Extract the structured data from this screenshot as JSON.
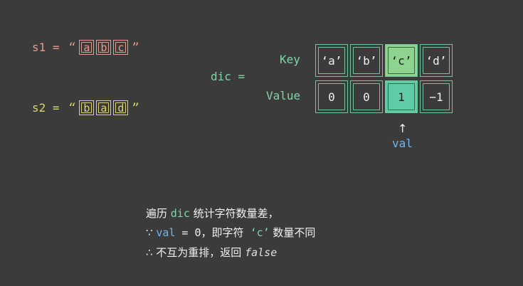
{
  "s1": {
    "label": "s1 = ",
    "open_quote": "“",
    "close_quote": "”",
    "chars": [
      "a",
      "b",
      "c"
    ]
  },
  "s2": {
    "label": "s2 = ",
    "open_quote": "“",
    "close_quote": "”",
    "chars": [
      "b",
      "a",
      "d"
    ]
  },
  "dic": {
    "label": "dic =",
    "key_label": "Key",
    "value_label": "Value",
    "keys": [
      "‘a’",
      "‘b’",
      "‘c’",
      "‘d’"
    ],
    "values": [
      "0",
      "0",
      "1",
      "−1"
    ],
    "highlight_index": 2
  },
  "pointer": {
    "arrow": "↑",
    "label": "val"
  },
  "notes": {
    "line1": {
      "pre": "遍历 ",
      "code": "dic",
      "post": " 统计字符数量差，"
    },
    "line2": {
      "sym": "∵ ",
      "var": "val",
      "mid": " = 0，即字符 ",
      "char": "‘c’",
      "post": " 数量不同"
    },
    "line3": {
      "sym": "∴ 不互为重排，返回 ",
      "result": "false"
    }
  },
  "colors": {
    "background": "#3b3b3b",
    "s1": "#e99a8c",
    "s2": "#ddd56f",
    "dic": "#7fd4a8",
    "highlight_key": "#8fd390",
    "highlight_value": "#5ecda6",
    "val": "#6fb6ee"
  }
}
